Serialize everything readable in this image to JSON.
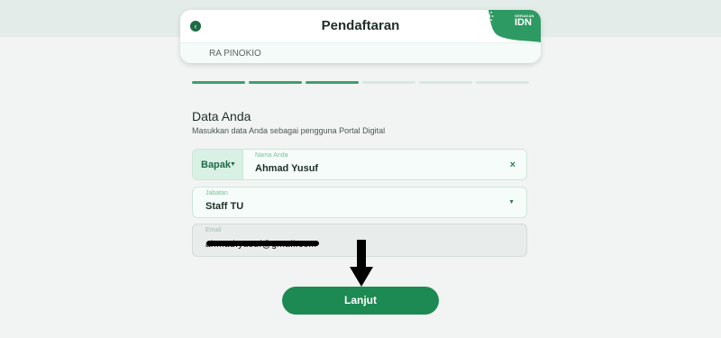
{
  "header": {
    "title": "Pendaftaran",
    "school": "RA PINOKIO",
    "back_icon": "chevron-left-icon",
    "logo_small_text": "GERAKAN",
    "logo_text": "IDN"
  },
  "progress": {
    "total_steps": 6,
    "completed_steps": 3
  },
  "form": {
    "title": "Data Anda",
    "subtitle": "Masukkan data Anda sebagai pengguna Portal Digital",
    "salutation": "Bapak",
    "name_label": "Nama Anda",
    "name_value": "Ahmad Yusuf",
    "clear_icon": "×",
    "job_label": "Jabatan",
    "job_value": "Staff TU",
    "email_label": "Email",
    "email_value": "ahmad.yusuf@gmail.com"
  },
  "actions": {
    "next_label": "Lanjut"
  },
  "colors": {
    "primary": "#1c8a52",
    "accent": "#3f9d6f",
    "brand_dark": "#1d6b45"
  }
}
